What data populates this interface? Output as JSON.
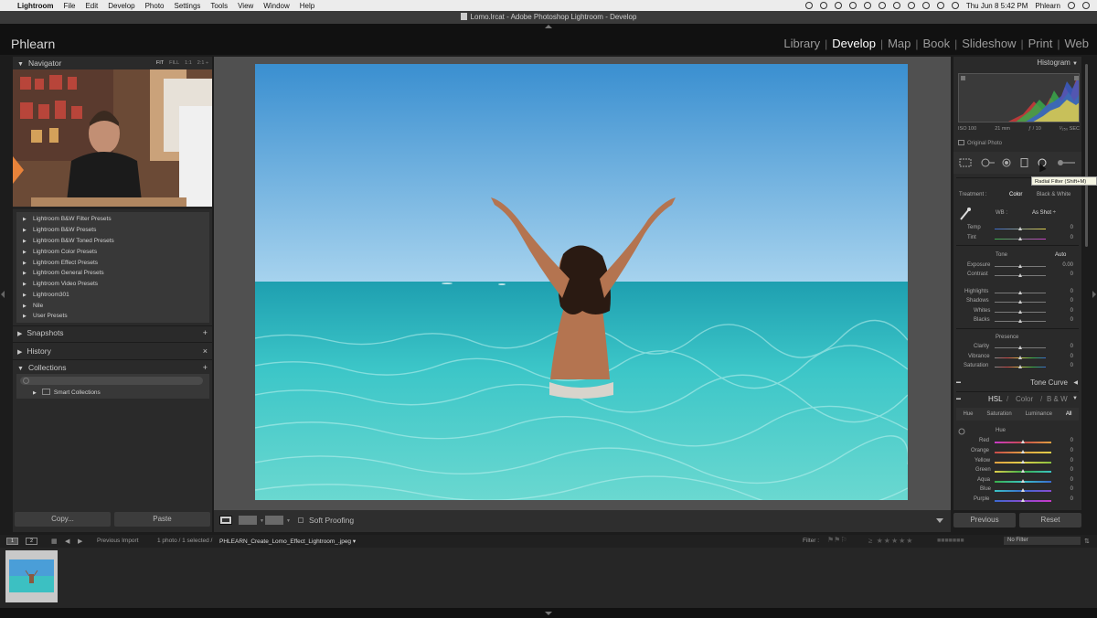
{
  "menubar": {
    "app": "Lightroom",
    "items": [
      "File",
      "Edit",
      "Develop",
      "Photo",
      "Settings",
      "Tools",
      "View",
      "Window",
      "Help"
    ],
    "datetime": "Thu Jun 8  5:42 PM",
    "user": "Phlearn"
  },
  "window": {
    "title": "Lomo.lrcat - Adobe Photoshop Lightroom - Develop"
  },
  "identity": "Phlearn",
  "modules": [
    "Library",
    "Develop",
    "Map",
    "Book",
    "Slideshow",
    "Print",
    "Web"
  ],
  "active_module": "Develop",
  "left": {
    "navigator": {
      "title": "Navigator",
      "zoom": [
        "FIT",
        "FILL",
        "1:1",
        "2:1 ÷"
      ]
    },
    "presets": [
      "Lightroom B&W Filter Presets",
      "Lightroom B&W Presets",
      "Lightroom B&W Toned Presets",
      "Lightroom Color Presets",
      "Lightroom Effect Presets",
      "Lightroom General Presets",
      "Lightroom Video Presets",
      "Lightroom301",
      "Nile",
      "User Presets"
    ],
    "snapshots": "Snapshots",
    "history": "History",
    "collections": "Collections",
    "smart_collections": "Smart Collections",
    "copy": "Copy...",
    "paste": "Paste"
  },
  "toolbar": {
    "soft_proofing": "Soft Proofing"
  },
  "right": {
    "histogram": "Histogram",
    "meta": [
      "ISO 100",
      "21 mm",
      "ƒ / 10",
      "¹⁄₂₅₀ SEC"
    ],
    "original_photo": "Original Photo",
    "tooltip": "Radial Filter (Shift+M)",
    "treatment_label": "Treatment :",
    "treatment_color": "Color",
    "treatment_bw": "Black & White",
    "wb_label": "WB :",
    "wb_value": "As Shot ÷",
    "tone": "Tone",
    "auto": "Auto",
    "presence": "Presence",
    "tone_curve": "Tone Curve",
    "hsl": "HSL",
    "color": "Color",
    "bw": "B & W",
    "hsl_tabs": [
      "Hue",
      "Saturation",
      "Luminance",
      "All"
    ],
    "hue": "Hue",
    "previous": "Previous",
    "reset": "Reset"
  },
  "sliders": {
    "temp": {
      "label": "Temp",
      "value": "0"
    },
    "tint": {
      "label": "Tint",
      "value": "0"
    },
    "exposure": {
      "label": "Exposure",
      "value": "0.00"
    },
    "contrast": {
      "label": "Contrast",
      "value": "0"
    },
    "highlights": {
      "label": "Highlights",
      "value": "0"
    },
    "shadows": {
      "label": "Shadows",
      "value": "0"
    },
    "whites": {
      "label": "Whites",
      "value": "0"
    },
    "blacks": {
      "label": "Blacks",
      "value": "0"
    },
    "clarity": {
      "label": "Clarity",
      "value": "0"
    },
    "vibrance": {
      "label": "Vibrance",
      "value": "0"
    },
    "saturation": {
      "label": "Saturation",
      "value": "0"
    },
    "hsl_red": {
      "label": "Red",
      "value": "0"
    },
    "hsl_orange": {
      "label": "Orange",
      "value": "0"
    },
    "hsl_yellow": {
      "label": "Yellow",
      "value": "0"
    },
    "hsl_green": {
      "label": "Green",
      "value": "0"
    },
    "hsl_aqua": {
      "label": "Aqua",
      "value": "0"
    },
    "hsl_blue": {
      "label": "Blue",
      "value": "0"
    },
    "hsl_purple": {
      "label": "Purple",
      "value": "0"
    }
  },
  "filmbar": {
    "view1": "1",
    "view2": "2",
    "source": "Previous Import",
    "count": "1 photo / 1 selected /",
    "filename": "PHLEARN_Create_Lomo_Effect_Lightroom_.jpeg ▾",
    "filter_label": "Filter :",
    "filter_value": "No Filter"
  },
  "colors": {
    "bg": "#1c1c1c",
    "panel": "#2a2a2a",
    "center": "#505050",
    "sky": "#4aa0d8",
    "sea": "#3fc4c4"
  }
}
